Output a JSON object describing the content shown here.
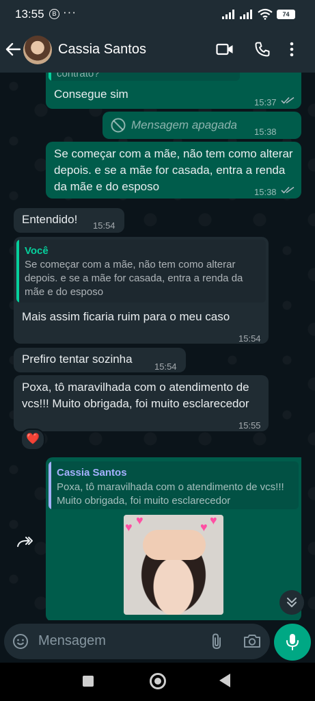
{
  "status_bar": {
    "time": "13:55",
    "notification_icon": "B",
    "more": "···",
    "battery": "74"
  },
  "header": {
    "contact_name": "Cassia Santos"
  },
  "messages": [
    {
      "id": "m1",
      "dir": "out",
      "quote_fragment": "contrato?",
      "text": "Consegue sim",
      "time": "15:37",
      "read": true
    },
    {
      "id": "m2",
      "dir": "out",
      "deleted": true,
      "text": "Mensagem apagada",
      "time": "15:38"
    },
    {
      "id": "m3",
      "dir": "out",
      "text": "Se começar com a mãe, não tem como alterar depois. e se a mãe for casada, entra a renda da mãe e do esposo",
      "time": "15:38",
      "read": true
    },
    {
      "id": "m4",
      "dir": "in",
      "text": "Entendido!",
      "time": "15:54"
    },
    {
      "id": "m5",
      "dir": "in",
      "quote_author": "Você",
      "quote_text": "Se começar com a mãe, não tem como alterar depois. e se a mãe for casada, entra a renda da mãe e do esposo",
      "text": "Mais assim ficaria ruim para o meu caso",
      "time": "15:54"
    },
    {
      "id": "m6",
      "dir": "in",
      "text": "Prefiro tentar sozinha",
      "time": "15:54"
    },
    {
      "id": "m7",
      "dir": "in",
      "text": "Poxa, tô maravilhada com o atendimento de vcs!!! Muito obrigada, foi muito esclarecedor",
      "time": "15:55",
      "reaction": "❤️"
    },
    {
      "id": "m8",
      "dir": "out",
      "quote_author": "Cassia Santos",
      "quote_text": "Poxa, tô maravilhada com o atendimento de vcs!!! Muito obrigada, foi muito esclarecedor",
      "sticker": "heart-hands-baby-sticker"
    }
  ],
  "input": {
    "placeholder": "Mensagem"
  },
  "colors": {
    "outgoing": "#005c4b",
    "incoming": "#202c33",
    "accent": "#00a884",
    "quote_you": "#06cf9c",
    "quote_contact": "#a5b0fe"
  },
  "icons": [
    "back-arrow-icon",
    "video-call-icon",
    "phone-icon",
    "menu-icon",
    "deleted-icon",
    "double-check-icon",
    "forward-icon",
    "scroll-down-icon",
    "emoji-icon",
    "attach-icon",
    "camera-icon",
    "mic-icon"
  ]
}
